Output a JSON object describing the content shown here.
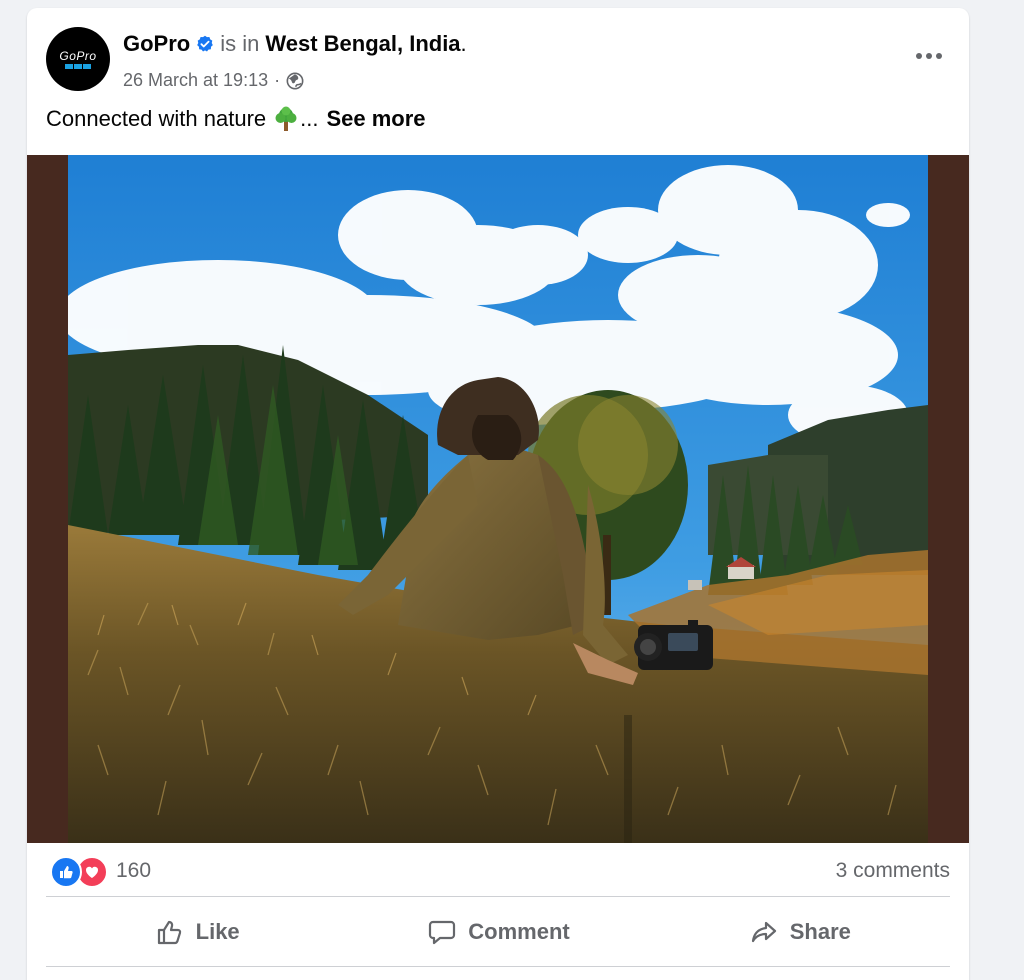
{
  "post": {
    "author": {
      "name": "GoPro",
      "verified": true,
      "avatar_logo_text": "GoPro"
    },
    "is_in_text": "is in",
    "location": "West Bengal, India",
    "location_suffix": ".",
    "timestamp": "26 March at 19:13",
    "audience_separator": "·",
    "audience_icon": "globe-icon",
    "more_icon": "more-options-icon",
    "text": "Connected with nature",
    "text_emoji": "tree-emoji",
    "ellipsis": "...",
    "see_more": "See more",
    "photo_description_icon": "photo"
  },
  "reactions": {
    "icons": [
      "like-reaction-icon",
      "love-reaction-icon"
    ],
    "count": "160",
    "comments": "3 comments"
  },
  "actions": {
    "like": "Like",
    "comment": "Comment",
    "share": "Share"
  },
  "colors": {
    "accent": "#1877f2",
    "love": "#f33e58",
    "muted_text": "#65676b",
    "media_frame": "#47291f"
  }
}
